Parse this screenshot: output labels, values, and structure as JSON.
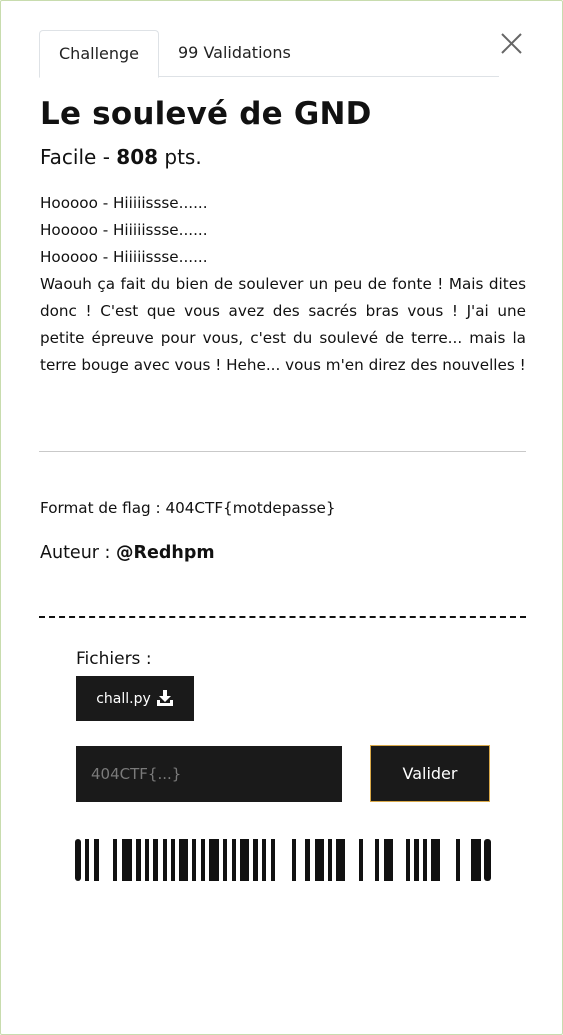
{
  "tabs": [
    {
      "label": "Challenge",
      "active": true
    },
    {
      "label": "99 Validations",
      "active": false
    }
  ],
  "challenge": {
    "title": "Le soulevé de GND",
    "difficulty": "Facile",
    "separator": " - ",
    "points": "808",
    "points_suffix": " pts.",
    "description": [
      "Hooooo - Hiiiiissse......",
      "Hooooo - Hiiiiissse......",
      "Hooooo - Hiiiiissse......",
      "Waouh ça fait du bien de soulever un peu de fonte ! Mais dites donc ! C'est que vous avez des sacrés bras vous ! J'ai une petite épreuve pour vous, c'est du soulevé de terre... mais la terre bouge avec vous ! Hehe... vous m'en direz des nouvelles !"
    ],
    "flag_format": "Format de flag : 404CTF{motdepasse}",
    "author_label": "Auteur : ",
    "author": "@Redhpm"
  },
  "files": {
    "label": "Fichiers :",
    "items": [
      {
        "name": "chall.py",
        "icon": "download-icon"
      }
    ]
  },
  "submit": {
    "placeholder": "404CTF{...}",
    "value": "",
    "button_label": "Valider"
  },
  "icons": {
    "close": "close-icon",
    "download": "download-icon"
  },
  "colors": {
    "dark": "#1a1a1a",
    "accent_border": "#d9a94a",
    "modal_border": "#c8dcae"
  }
}
